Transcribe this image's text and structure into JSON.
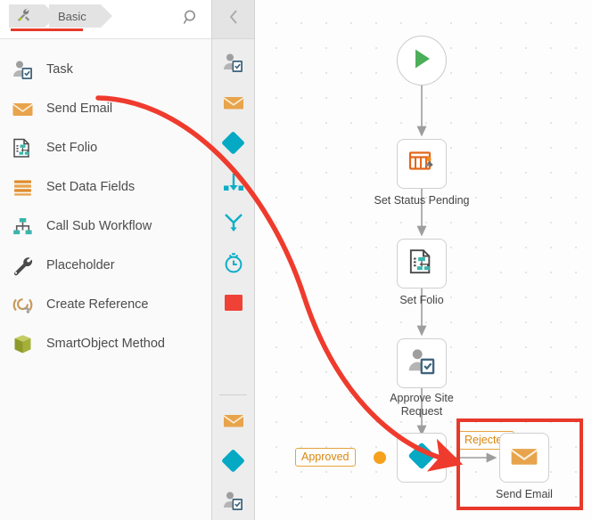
{
  "breadcrumb": {
    "tools_icon": "tools-icon",
    "items": [
      "Basic"
    ]
  },
  "search": {
    "icon": "search-icon",
    "label": "Search"
  },
  "collapse": {
    "icon": "chevron-left-icon",
    "label": "Collapse panel"
  },
  "palette": {
    "items": [
      {
        "label": "Task",
        "icon": "task-icon"
      },
      {
        "label": "Send Email",
        "icon": "email-icon"
      },
      {
        "label": "Set Folio",
        "icon": "set-folio-icon"
      },
      {
        "label": "Set Data Fields",
        "icon": "set-data-fields-icon"
      },
      {
        "label": "Call Sub Workflow",
        "icon": "call-sub-workflow-icon"
      },
      {
        "label": "Placeholder",
        "icon": "wrench-icon"
      },
      {
        "label": "Create Reference",
        "icon": "create-reference-icon"
      },
      {
        "label": "SmartObject Method",
        "icon": "smartobject-method-icon"
      }
    ]
  },
  "strip": {
    "group_one": [
      "task-icon",
      "email-icon",
      "decision-diamond-icon",
      "merge-icon",
      "split-icon",
      "timer-icon",
      "stop-icon"
    ],
    "group_two": [
      "email-icon",
      "decision-diamond-icon",
      "task-icon"
    ]
  },
  "canvas": {
    "nodes": [
      {
        "name": "start",
        "label": "",
        "icon": "play-icon"
      },
      {
        "name": "set-status-pending",
        "label": "Set Status Pending",
        "icon": "set-status-icon"
      },
      {
        "name": "set-folio",
        "label": "Set Folio",
        "icon": "set-folio-icon"
      },
      {
        "name": "approve-site-request",
        "label": "Approve Site\nRequest",
        "icon": "task-icon"
      },
      {
        "name": "decision",
        "label": "",
        "icon": "decision-diamond-icon"
      },
      {
        "name": "send-email",
        "label": "Send Email",
        "icon": "email-icon"
      }
    ],
    "badges": [
      {
        "name": "approved",
        "label": "Approved"
      },
      {
        "name": "rejected",
        "label": "Rejected"
      }
    ]
  },
  "colors": {
    "accent_red": "#e8392b",
    "teal": "#05a9c4",
    "orange": "#e8a44c",
    "green": "#4cae58",
    "badge_orange": "#d9860f",
    "olive": "#9aa832",
    "slate": "#4a6d84"
  }
}
